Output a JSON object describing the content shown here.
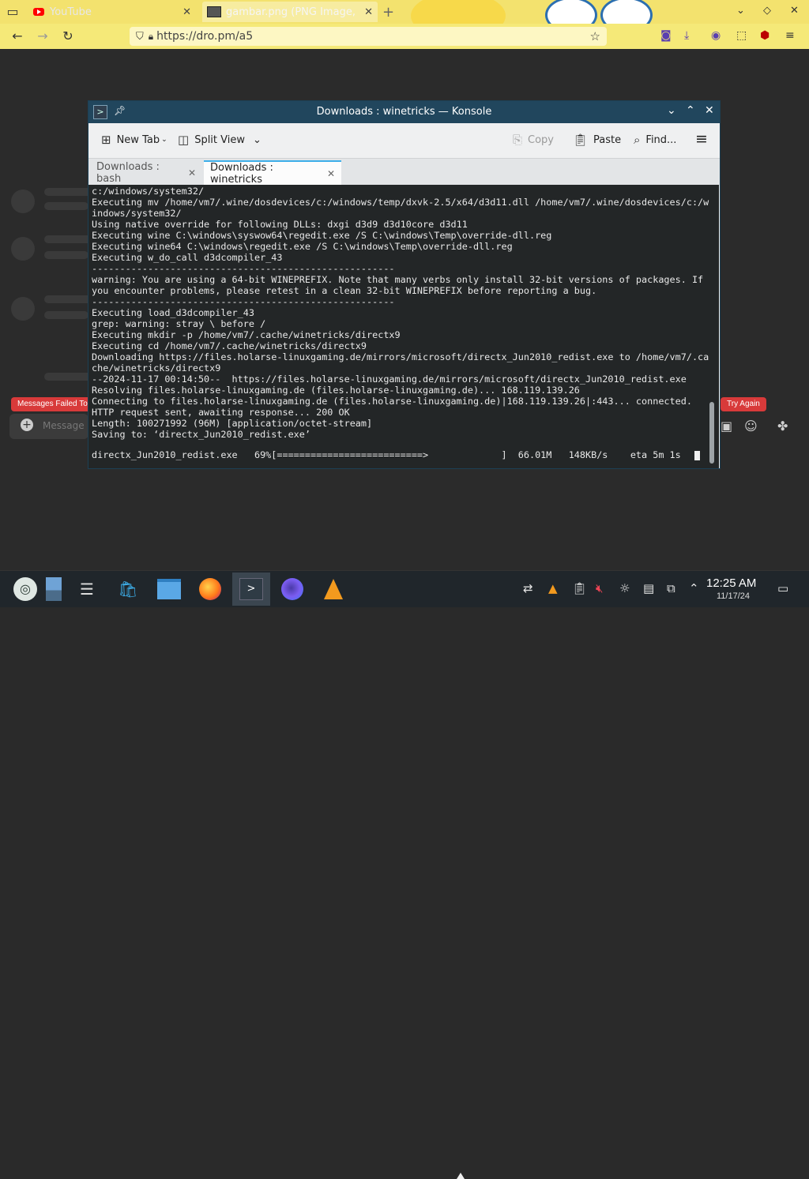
{
  "browser": {
    "tabs": [
      {
        "title": "YouTube",
        "active": false
      },
      {
        "title": "gambar.png (PNG Image,",
        "active": true
      }
    ],
    "url": "https://dro.pm/a5",
    "new_tab_glyph": "+"
  },
  "page": {
    "error_left": "Messages Failed To",
    "error_right": "Try Again",
    "message_placeholder": "Message"
  },
  "konsole": {
    "title": "Downloads : winetricks — Konsole",
    "toolbar": {
      "new_tab": "New Tab",
      "split_view": "Split View",
      "copy": "Copy",
      "paste": "Paste",
      "find": "Find..."
    },
    "tabs": [
      {
        "label": "Downloads : bash",
        "active": false
      },
      {
        "label": "Downloads : winetricks",
        "active": true
      }
    ],
    "terminal_lines": [
      "c:/windows/system32/",
      "Executing mv /home/vm7/.wine/dosdevices/c:/windows/temp/dxvk-2.5/x64/d3d11.dll /home/vm7/.wine/dosdevices/c:/w",
      "indows/system32/",
      "Using native override for following DLLs: dxgi d3d9 d3d10core d3d11",
      "Executing wine C:\\windows\\syswow64\\regedit.exe /S C:\\windows\\Temp\\override-dll.reg",
      "Executing wine64 C:\\windows\\regedit.exe /S C:\\windows\\Temp\\override-dll.reg",
      "Executing w_do_call d3dcompiler_43",
      "------------------------------------------------------",
      "warning: You are using a 64-bit WINEPREFIX. Note that many verbs only install 32-bit versions of packages. If",
      "you encounter problems, please retest in a clean 32-bit WINEPREFIX before reporting a bug.",
      "------------------------------------------------------",
      "Executing load_d3dcompiler_43",
      "grep: warning: stray \\ before /",
      "Executing mkdir -p /home/vm7/.cache/winetricks/directx9",
      "Executing cd /home/vm7/.cache/winetricks/directx9",
      "Downloading https://files.holarse-linuxgaming.de/mirrors/microsoft/directx_Jun2010_redist.exe to /home/vm7/.ca",
      "che/winetricks/directx9",
      "--2024-11-17 00:14:50--  https://files.holarse-linuxgaming.de/mirrors/microsoft/directx_Jun2010_redist.exe",
      "Resolving files.holarse-linuxgaming.de (files.holarse-linuxgaming.de)... 168.119.139.26",
      "Connecting to files.holarse-linuxgaming.de (files.holarse-linuxgaming.de)|168.119.139.26|:443... connected.",
      "HTTP request sent, awaiting response... 200 OK",
      "Length: 100271992 (96M) [application/octet-stream]",
      "Saving to: ‘directx_Jun2010_redist.exe’"
    ],
    "progress_line": "directx_Jun2010_redist.exe   69%[==========================>             ]  66.01M   148KB/s    eta 5m 1s",
    "download_percent": 69
  },
  "taskbar": {
    "time": "12:25 AM",
    "date": "11/17/24"
  },
  "colors": {
    "titlebar": "#21465d",
    "terminal_bg": "#232627",
    "active_tab_accent": "#3daee9",
    "browser_theme": "#f3e26e"
  }
}
